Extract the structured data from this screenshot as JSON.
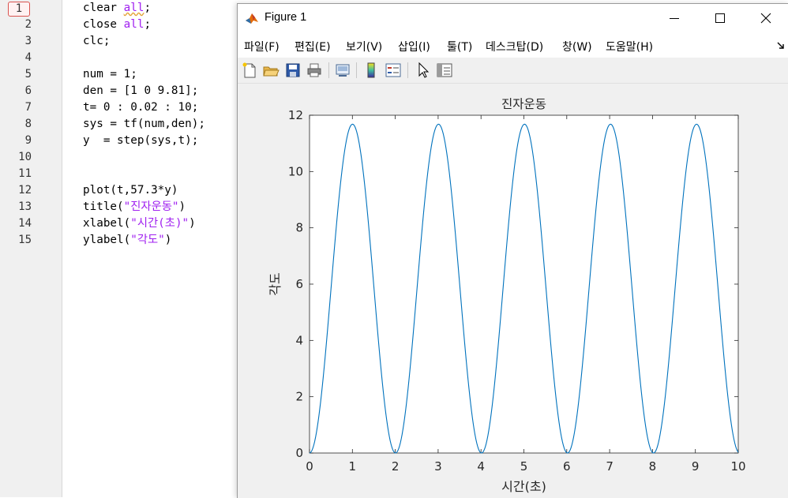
{
  "editor": {
    "line_numbers": [
      "1",
      "2",
      "3",
      "4",
      "5",
      "6",
      "7",
      "8",
      "9",
      "10",
      "11",
      "12",
      "13",
      "14",
      "15"
    ],
    "breakpoint_line": "1",
    "lines": {
      "l1": {
        "a": "clear ",
        "b": "all",
        "c": ";"
      },
      "l2": {
        "a": "close ",
        "b": "all",
        "c": ";"
      },
      "l3": "clc;",
      "l5": "num = 1;",
      "l6": "den = [1 0 9.81];",
      "l7": "t= 0 : 0.02 : 10;",
      "l8": "sys = tf(num,den);",
      "l9": "y  = step(sys,t);",
      "l12": "plot(t,57.3*y)",
      "l13": {
        "a": "title(",
        "b": "\"진자운동\"",
        "c": ")"
      },
      "l14": {
        "a": "xlabel(",
        "b": "\"시간(초)\"",
        "c": ")"
      },
      "l15": {
        "a": "ylabel(",
        "b": "\"각도\"",
        "c": ")"
      }
    }
  },
  "figure": {
    "title": "Figure 1",
    "menu": [
      "파일(F)",
      "편집(E)",
      "보기(V)",
      "삽입(I)",
      "툴(T)",
      "데스크탑(D)",
      "창(W)",
      "도움말(H)"
    ],
    "toolbar_icons": [
      "new-figure-icon",
      "open-file-icon",
      "save-icon",
      "print-icon",
      "link-plot-icon",
      "insert-colorbar-icon",
      "insert-legend-icon",
      "edit-plot-arrow-icon",
      "show-plot-tools-icon"
    ]
  },
  "chart_data": {
    "type": "line",
    "title": "진자운동",
    "xlabel": "시간(초)",
    "ylabel": "각도",
    "xlim": [
      0,
      10
    ],
    "ylim": [
      0,
      12
    ],
    "xticks": [
      "0",
      "1",
      "2",
      "3",
      "4",
      "5",
      "6",
      "7",
      "8",
      "9",
      "10"
    ],
    "yticks": [
      "0",
      "2",
      "4",
      "6",
      "8",
      "10",
      "12"
    ],
    "series": [
      {
        "function": "57.3*(1-cos(3.1321*t))/9.81",
        "t_start": 0,
        "t_end": 10,
        "t_step": 0.02,
        "peak_value": 11.68,
        "peaks_at_t": [
          1.0,
          3.0,
          5.0,
          7.0,
          9.0
        ],
        "zeros_at_t": [
          0,
          2.0,
          4.0,
          6.0,
          8.0,
          10.0
        ],
        "color": "#0072bd"
      }
    ],
    "grid": false
  }
}
